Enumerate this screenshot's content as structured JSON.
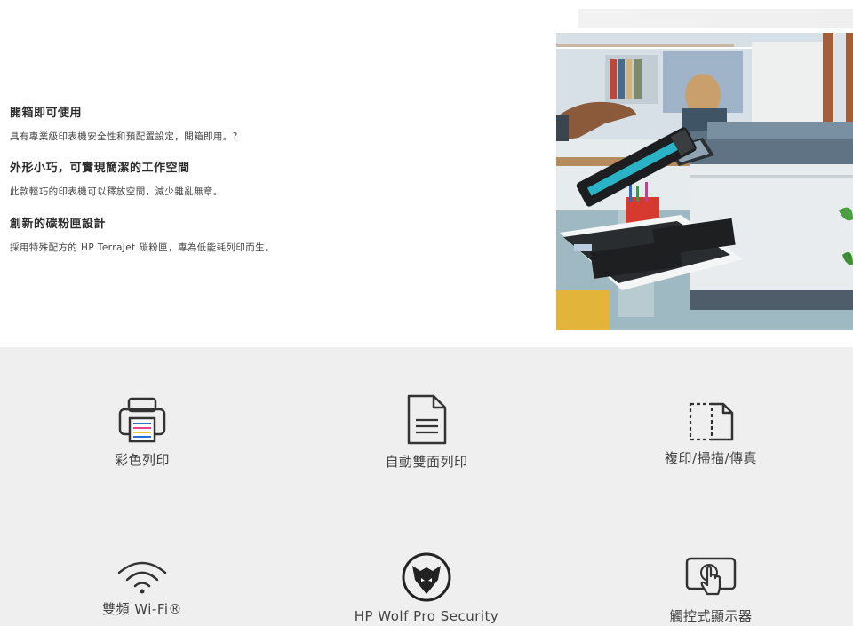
{
  "features": [
    {
      "title": "開箱即可使用",
      "desc": "具有專業級印表機安全性和預配置設定，開箱即用。?"
    },
    {
      "title": "外形小巧，可實現簡潔的工作空間",
      "desc": "此款輕巧的印表機可以釋放空間，減少雜亂無章。"
    },
    {
      "title": "創新的碳粉匣設計",
      "desc": "採用特殊配方的 HP TerraJet 碳粉匣，專為低能耗列印而生。"
    }
  ],
  "icon_grid": [
    {
      "icon": "printer-icon",
      "label": "彩色列印"
    },
    {
      "icon": "document-icon",
      "label": "自動雙面列印"
    },
    {
      "icon": "copy-scan-icon",
      "label": "複印/掃描/傳真"
    },
    {
      "icon": "wifi-icon",
      "label": "雙頻 Wi-Fi®"
    },
    {
      "icon": "hp-wolf-icon",
      "label": "HP Wolf Pro Security"
    },
    {
      "icon": "touchscreen-icon",
      "label": "觸控式顯示器"
    }
  ]
}
